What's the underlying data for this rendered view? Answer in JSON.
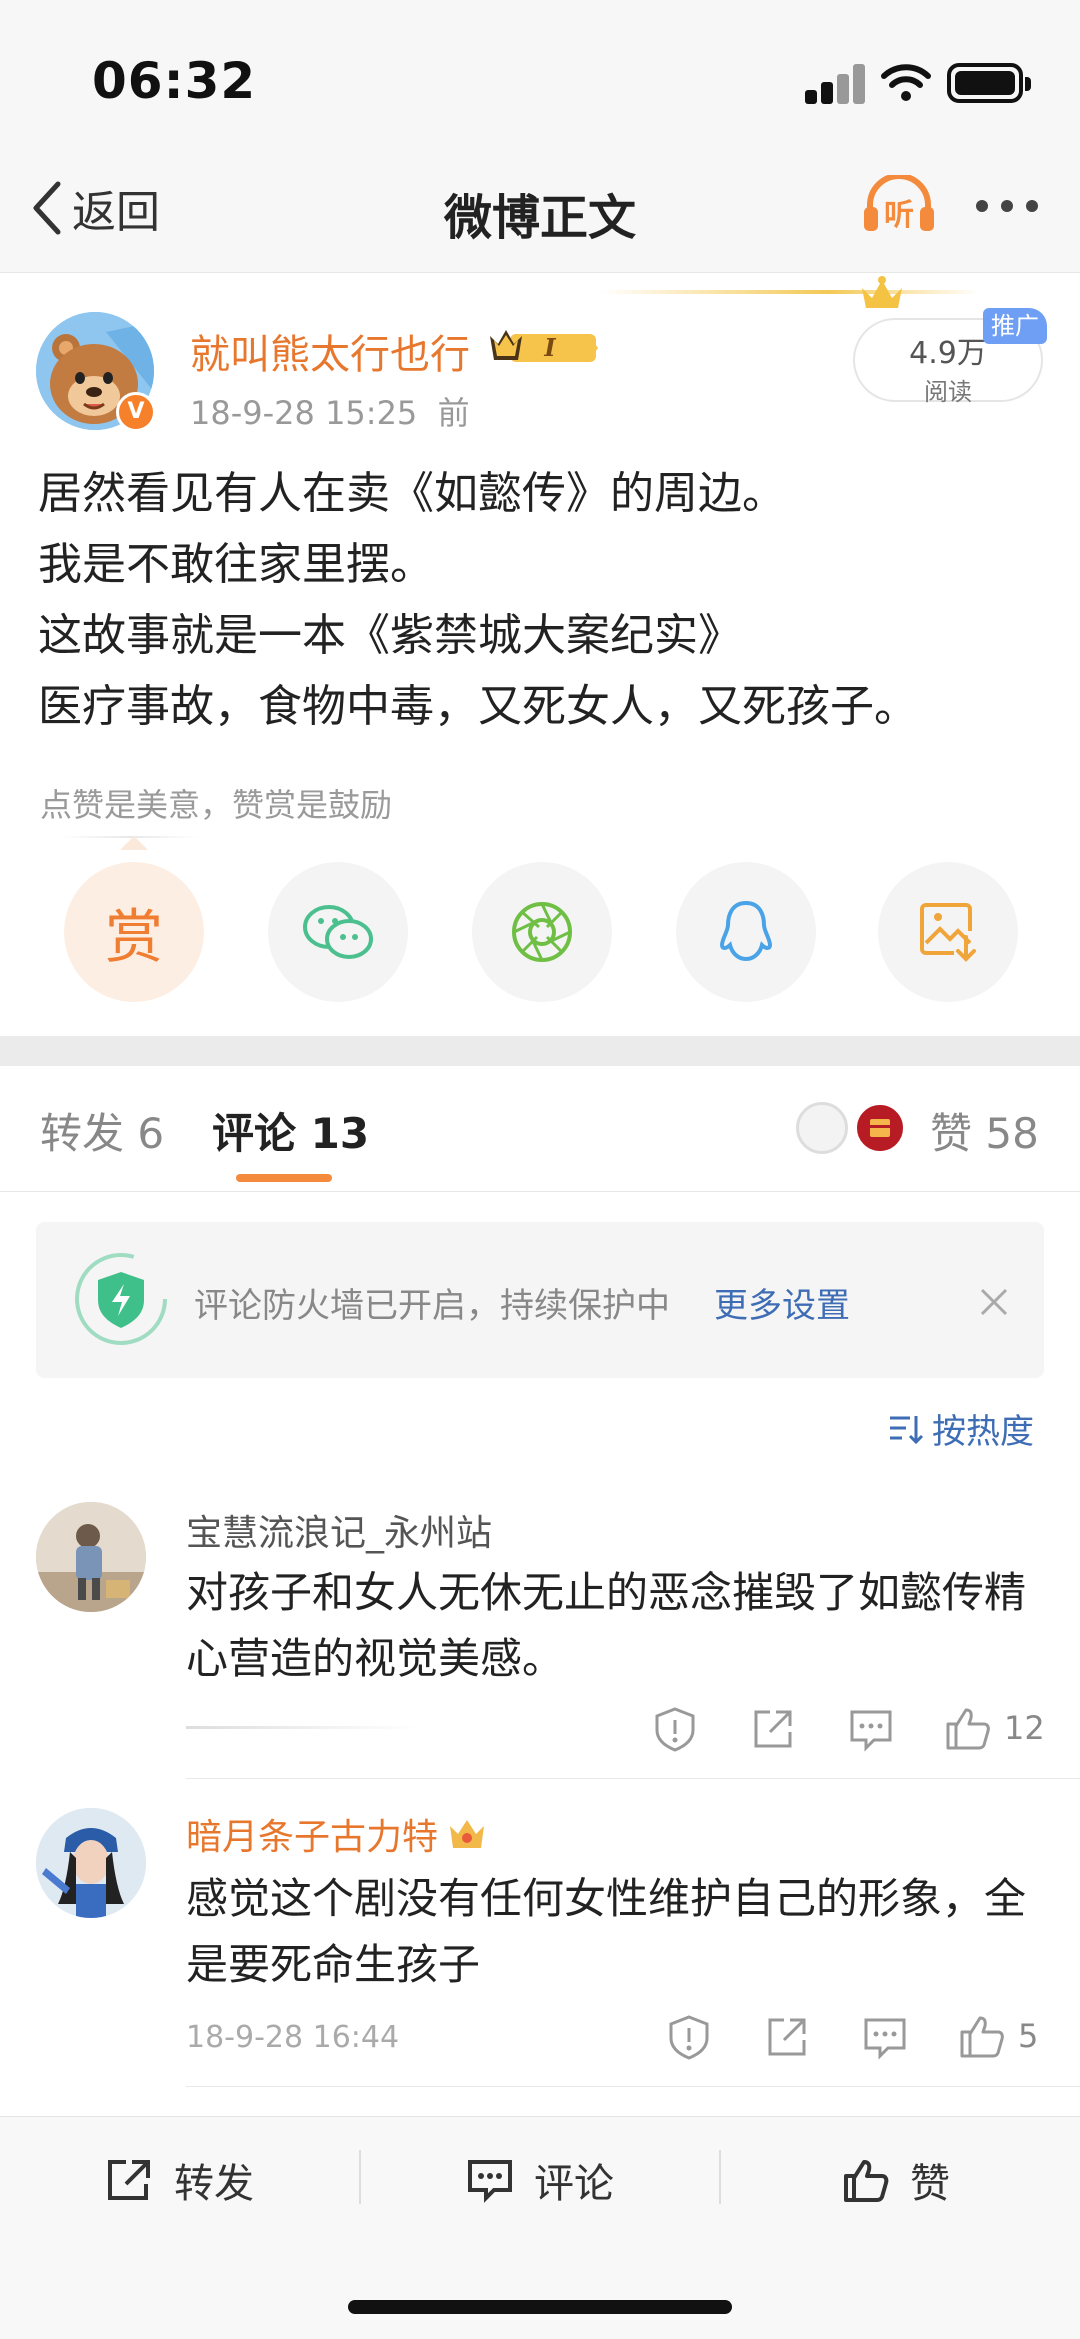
{
  "status": {
    "time": "06:32"
  },
  "nav": {
    "back_label": "返回",
    "title": "微博正文"
  },
  "post": {
    "author": "就叫熊太行也行",
    "vip_level": "I",
    "timestamp": "18-9-28 15:25",
    "timestamp_suffix": "前",
    "read_count": "4.9万",
    "read_label": "阅读",
    "promo_label": "推广",
    "lines": [
      "居然看见有人在卖《如懿传》的周边。",
      "我是不敢往家里摆。",
      "这故事就是一本《紫禁城大案纪实》",
      "医疗事故，食物中毒，又死女人，又死孩子。"
    ],
    "reward_hint": "点赞是美意，赞赏是鼓励",
    "reward_label": "赏"
  },
  "tabs": {
    "repost": "转发 6",
    "comment": "评论 13",
    "likes": "赞 58"
  },
  "firewall": {
    "text": "评论防火墙已开启，持续保护中",
    "link": "更多设置"
  },
  "sort_label": "按热度",
  "comments": [
    {
      "user": "宝慧流浪记_永州站",
      "text": "对孩子和女人无休无止的恶念摧毁了如懿传精心营造的视觉美感。",
      "time": "",
      "likes": "12"
    },
    {
      "user": "暗月条子古力特",
      "text": "感觉这个剧没有任何女性维护自己的形象，全是要死命生孩子",
      "time": "18-9-28 16:44",
      "likes": "5"
    }
  ],
  "bottom": {
    "repost": "转发",
    "comment": "评论",
    "like": "赞"
  },
  "colors": {
    "accent": "#e8772e",
    "link": "#3e6db5",
    "tab_underline": "#f38a3c"
  }
}
